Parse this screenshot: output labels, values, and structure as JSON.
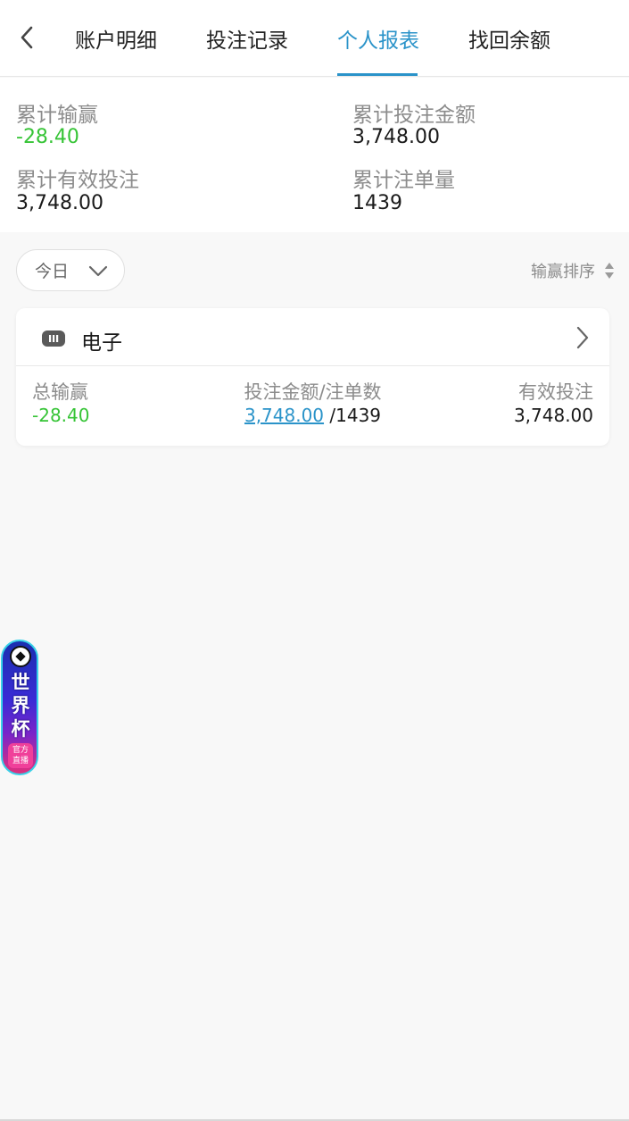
{
  "nav": {
    "tabs": [
      "账户明细",
      "投注记录",
      "个人报表",
      "找回余额"
    ],
    "active_tab": "个人报表"
  },
  "summary": {
    "total_win_loss_label": "累计输赢",
    "total_win_loss_value": "-28.40",
    "total_bet_amount_label": "累计投注金额",
    "total_bet_amount_value": "3,748.00",
    "total_valid_bet_label": "累计有效投注",
    "total_valid_bet_value": "3,748.00",
    "total_order_count_label": "累计注单量",
    "total_order_count_value": "1439"
  },
  "filter": {
    "period": "今日",
    "sort_label": "输赢排序"
  },
  "card": {
    "title": "电子",
    "icon": "gamepad-icon",
    "win_loss_label": "总输赢",
    "win_loss_value": "-28.40",
    "bet_label": "投注金额/注单数",
    "bet_amount": "3,748.00",
    "bet_count": " /1439",
    "valid_bet_label": "有效投注",
    "valid_bet_value": "3,748.00"
  },
  "floating_badge": {
    "chars": [
      "世",
      "界",
      "杯"
    ],
    "sub_line1": "官方",
    "sub_line2": "直播"
  },
  "colors": {
    "accent": "#2a93c9",
    "negative": "#36c436",
    "background": "#f8f8f8"
  }
}
